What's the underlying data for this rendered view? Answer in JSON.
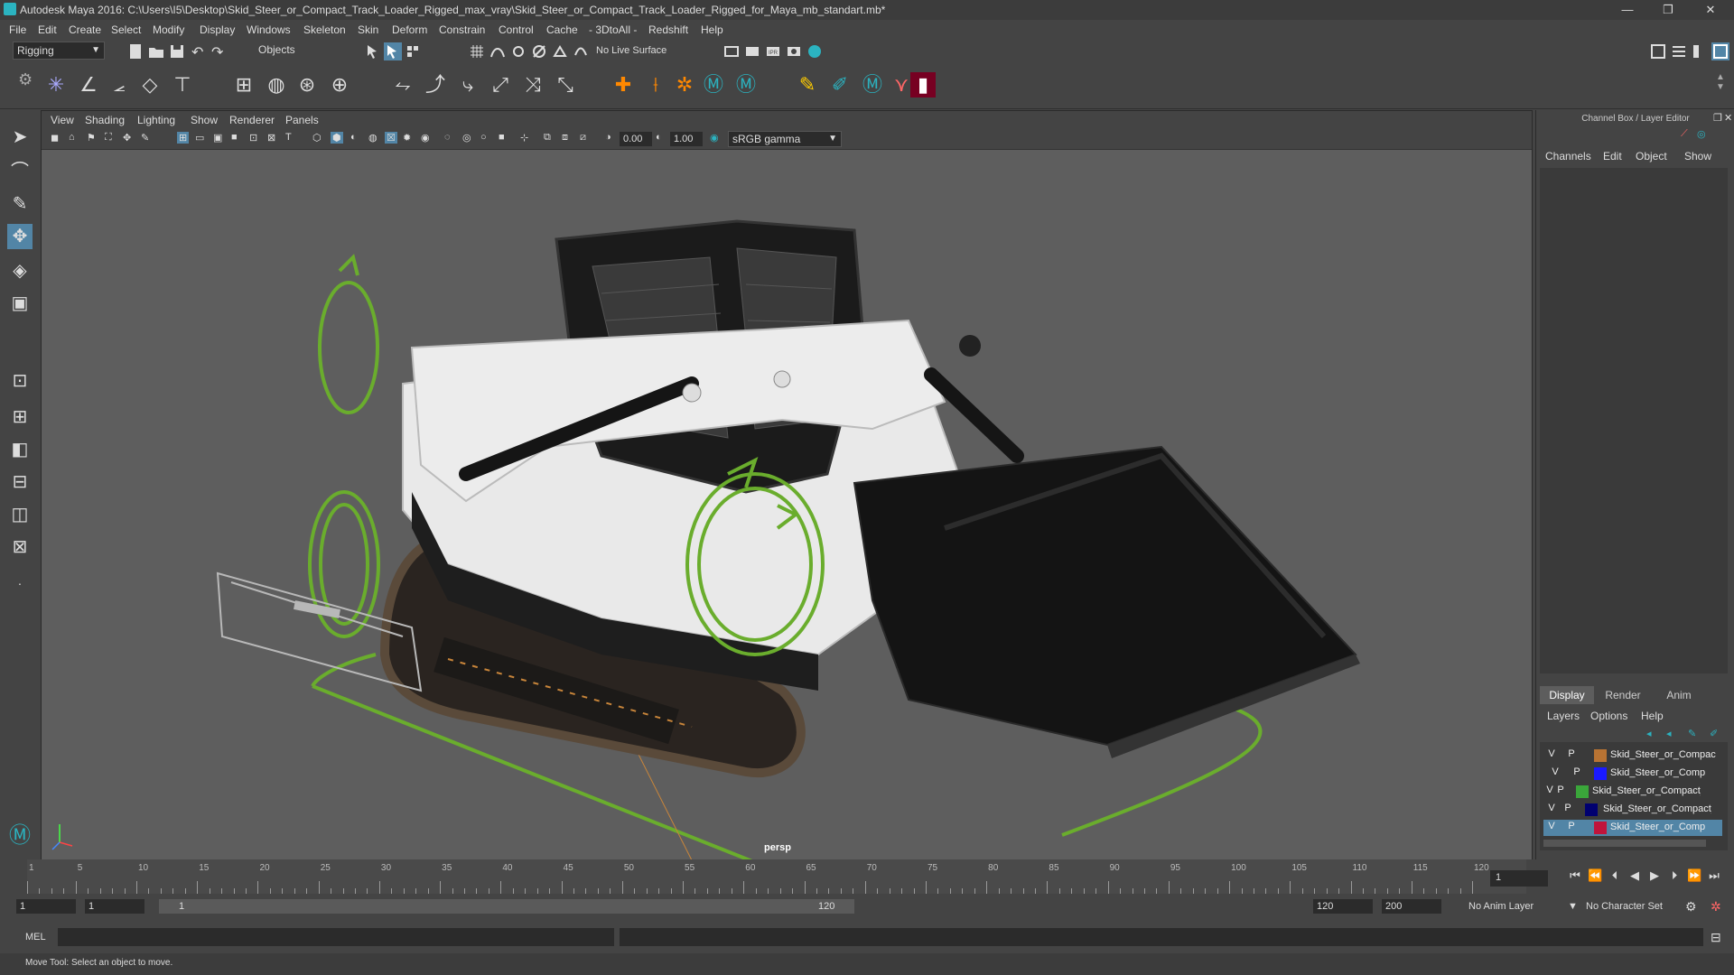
{
  "titlebar": {
    "title": "Autodesk Maya 2016: C:\\Users\\I5\\Desktop\\Skid_Steer_or_Compact_Track_Loader_Rigged_max_vray\\Skid_Steer_or_Compact_Track_Loader_Rigged_for_Maya_mb_standart.mb*",
    "minimize": "—",
    "restore": "❐",
    "close": "✕"
  },
  "menubar": [
    "File",
    "Edit",
    "Create",
    "Select",
    "Modify",
    "Display",
    "Windows",
    "Skeleton",
    "Skin",
    "Deform",
    "Constrain",
    "Control",
    "Cache",
    "- 3DtoAll -",
    "Redshift",
    "Help"
  ],
  "statusline": {
    "menuset": "Rigging",
    "selection_mode": "Objects",
    "live_surface": "No Live Surface"
  },
  "viewport": {
    "menu": [
      "View",
      "Shading",
      "Lighting",
      "Show",
      "Renderer",
      "Panels"
    ],
    "exposure": "0.00",
    "gamma": "1.00",
    "colorspace": "sRGB gamma",
    "camera_label": "persp"
  },
  "channelbox": {
    "title": "Channel Box / Layer Editor",
    "menu": [
      "Channels",
      "Edit",
      "Object",
      "Show"
    ]
  },
  "layer_editor": {
    "tabs": [
      "Display",
      "Render",
      "Anim"
    ],
    "menu": [
      "Layers",
      "Options",
      "Help"
    ],
    "layers": [
      {
        "v": "V",
        "p": "P",
        "color": "#b87333",
        "name": "Skid_Steer_or_Compac",
        "selected": false
      },
      {
        "v": "V",
        "p": "P",
        "color": "#1a1aff",
        "name": "Skid_Steer_or_Comp",
        "selected": false
      },
      {
        "v": "V",
        "p": "P",
        "color": "#3aa63a",
        "name": "Skid_Steer_or_Compact_Tr",
        "selected": false
      },
      {
        "v": "V",
        "p": "P",
        "color": "#000070",
        "name": "Skid_Steer_or_Compact_",
        "selected": false
      },
      {
        "v": "V",
        "p": "P",
        "color": "#c0143c",
        "name": "Skid_Steer_or_Comp",
        "selected": true
      }
    ]
  },
  "timeline": {
    "ticks": [
      1,
      5,
      10,
      15,
      20,
      25,
      30,
      35,
      40,
      45,
      50,
      55,
      60,
      65,
      70,
      75,
      80,
      85,
      90,
      95,
      100,
      105,
      110,
      115,
      120
    ],
    "current_frame": "1"
  },
  "range": {
    "start": "1",
    "playback_start": "1",
    "slider_start": "1",
    "slider_end": "120",
    "playback_end": "120",
    "end": "200",
    "anim_layer": "No Anim Layer",
    "character_set": "No Character Set"
  },
  "cmdline": {
    "lang": "MEL"
  },
  "helpline": {
    "text": "Move Tool: Select an object to move."
  }
}
